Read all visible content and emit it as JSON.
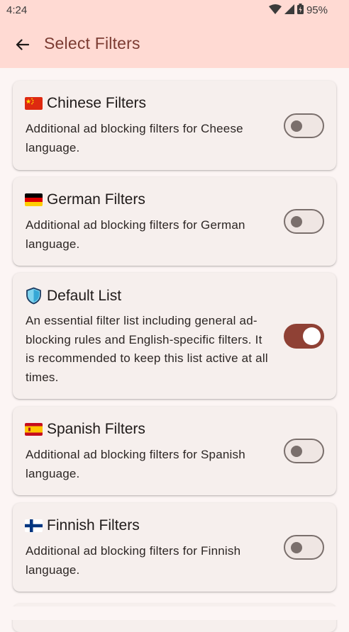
{
  "status_bar": {
    "time": "4:24",
    "battery": "95%"
  },
  "app_bar": {
    "title": "Select Filters",
    "back_icon": "arrow-back-icon"
  },
  "colors": {
    "app_bar_bg": "#ffdad3",
    "accent": "#8f4135",
    "title_color": "#7b3b32",
    "card_bg": "#f6efed"
  },
  "filters": [
    {
      "title": "Chinese Filters",
      "icon": "china-flag-icon",
      "description": "Additional ad blocking filters for Cheese language.",
      "enabled": false
    },
    {
      "title": "German Filters",
      "icon": "germany-flag-icon",
      "description": "Additional ad blocking filters for German language.",
      "enabled": false
    },
    {
      "title": "Default List",
      "icon": "shield-icon",
      "description": "An essential filter list including general ad-blocking rules and English-specific filters. It is recommended to keep this list active at all times.",
      "enabled": true
    },
    {
      "title": "Spanish Filters",
      "icon": "spain-flag-icon",
      "description": "Additional ad blocking filters for Spanish language.",
      "enabled": false
    },
    {
      "title": "Finnish Filters",
      "icon": "finland-flag-icon",
      "description": "Additional ad blocking filters for Finnish language.",
      "enabled": false
    }
  ]
}
